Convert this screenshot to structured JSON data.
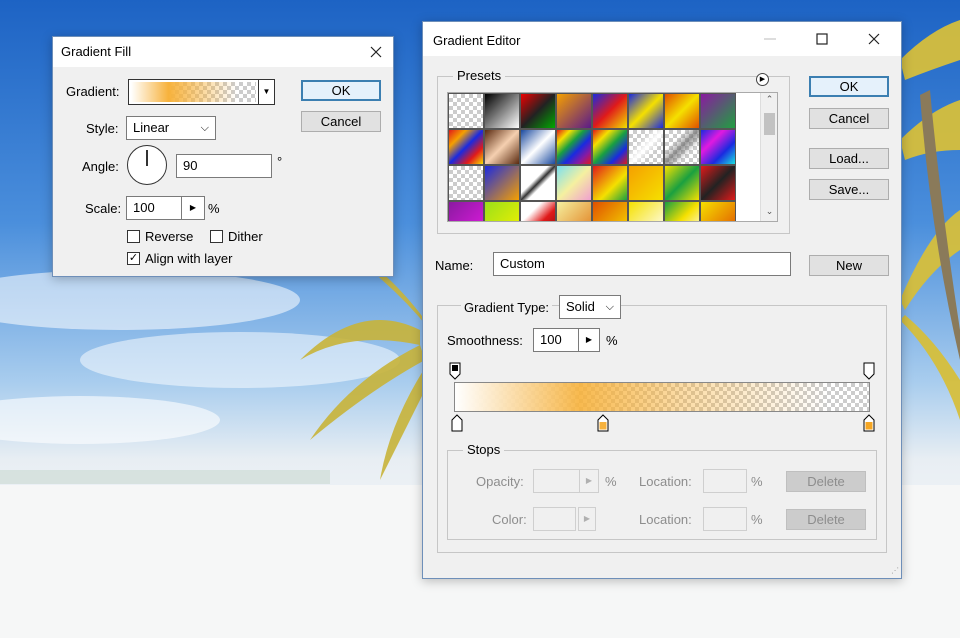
{
  "gradient_fill": {
    "title": "Gradient Fill",
    "close_icon": "close-icon",
    "gradient_label": "Gradient:",
    "style_label": "Style:",
    "style_value": "Linear",
    "angle_label": "Angle:",
    "angle_value": "90",
    "angle_unit": "°",
    "scale_label": "Scale:",
    "scale_value": "100",
    "scale_unit": "%",
    "reverse_label": "Reverse",
    "reverse_checked": false,
    "dither_label": "Dither",
    "dither_checked": false,
    "align_label": "Align with layer",
    "align_checked": true,
    "ok_label": "OK",
    "cancel_label": "Cancel"
  },
  "gradient_editor": {
    "title": "Gradient Editor",
    "presets_label": "Presets",
    "ok_label": "OK",
    "cancel_label": "Cancel",
    "load_label": "Load...",
    "save_label": "Save...",
    "name_label": "Name:",
    "name_value": "Custom",
    "new_label": "New",
    "gradient_type_label": "Gradient Type:",
    "gradient_type_value": "Solid",
    "smoothness_label": "Smoothness:",
    "smoothness_value": "100",
    "smoothness_unit": "%",
    "stops_label": "Stops",
    "opacity_label": "Opacity:",
    "opacity_unit": "%",
    "location_label": "Location:",
    "location_unit": "%",
    "color_label": "Color:",
    "delete_label": "Delete",
    "colors": {
      "stop_start": "#ffffff",
      "stop_mid": "#f7b23c",
      "stop_end": "#f5a623",
      "accent": "#3c7fb1"
    }
  }
}
